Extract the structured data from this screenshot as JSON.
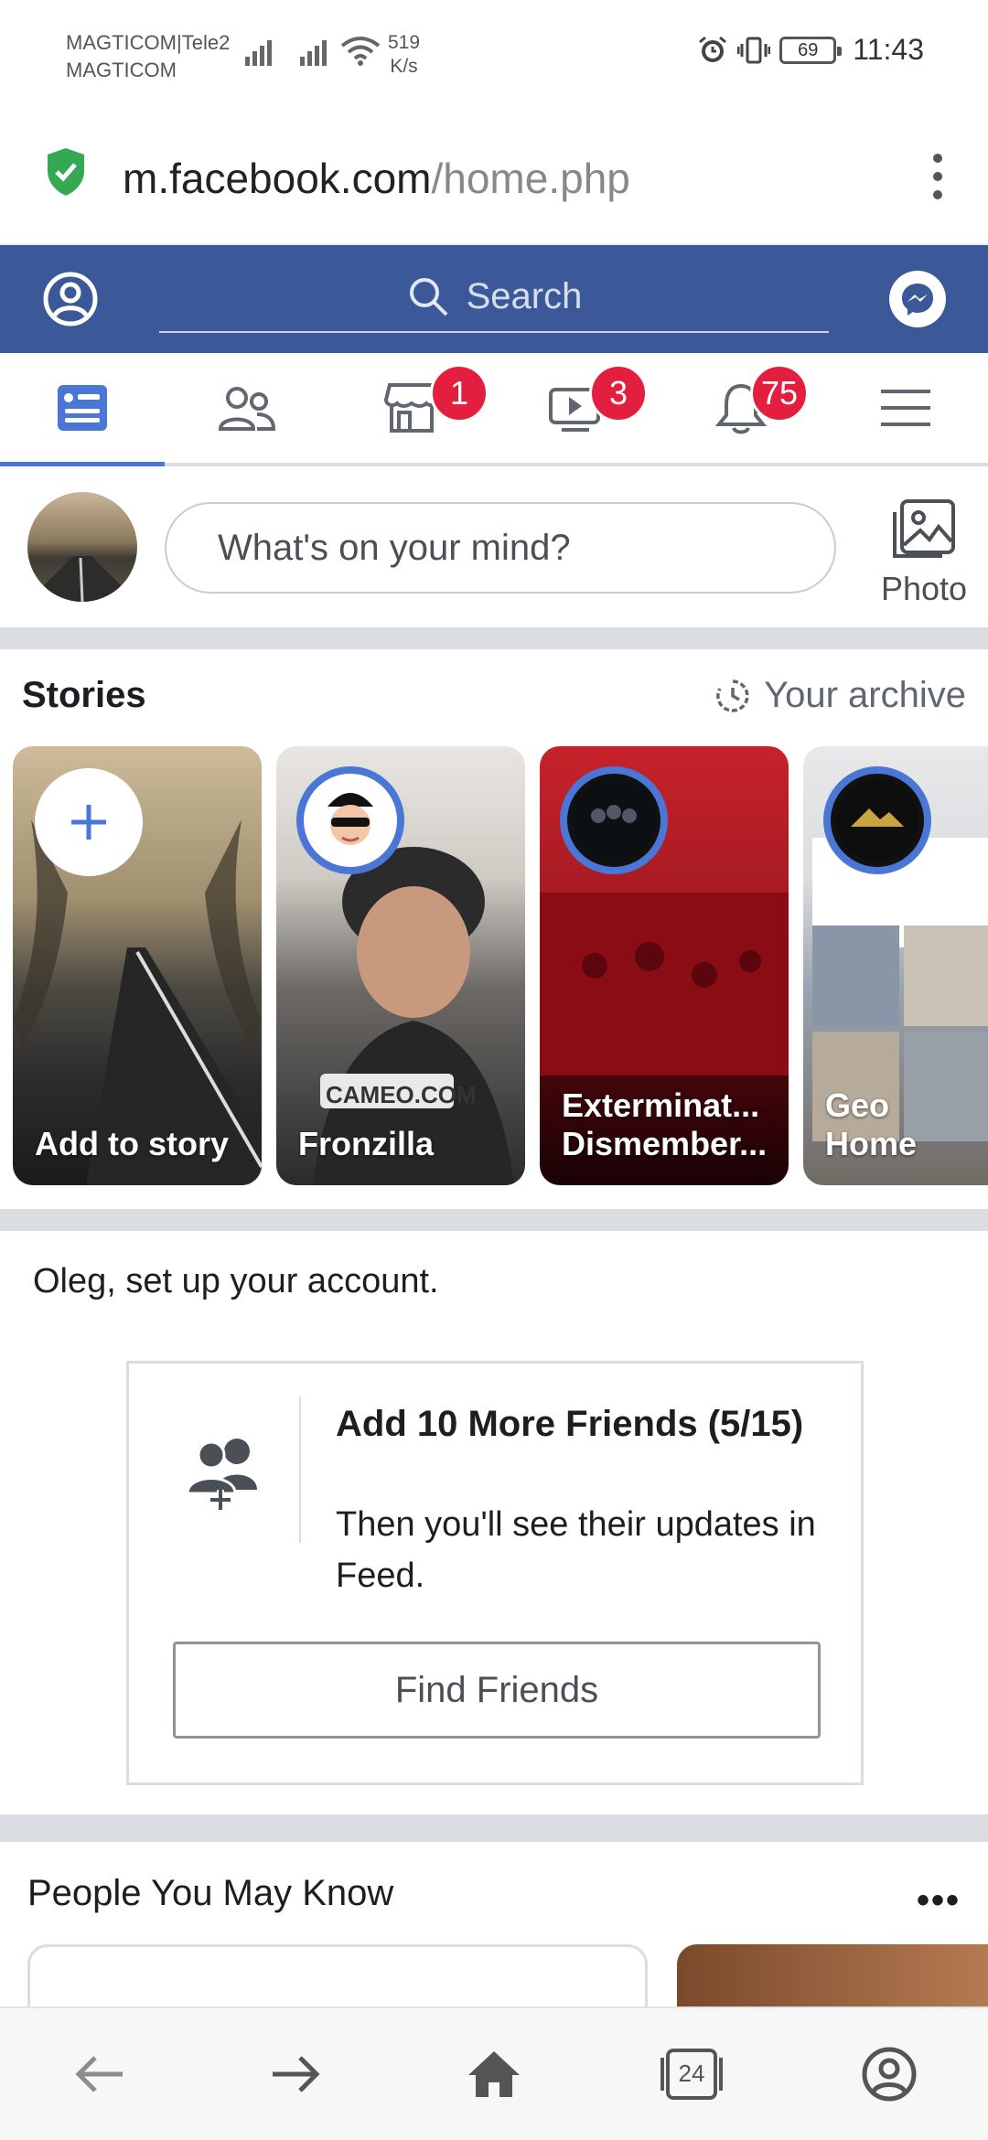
{
  "status_bar": {
    "carrier_line1": "MAGTICOM|Tele2",
    "carrier_line2": "MAGTICOM",
    "speed_value": "519",
    "speed_unit": "K/s",
    "battery": "69",
    "time": "11:43",
    "icons": [
      "signal-icon",
      "wifi-icon",
      "alarm-icon",
      "vibrate-icon",
      "battery-icon"
    ]
  },
  "browser": {
    "url_host": "m.facebook.com",
    "url_path": "/home.php",
    "icons": [
      "secure-shield-icon",
      "kebab-menu-icon"
    ]
  },
  "header": {
    "search_placeholder": "Search",
    "brand_color": "#3b5998",
    "icons": [
      "profile-icon",
      "search-icon",
      "messenger-icon"
    ]
  },
  "tabs": [
    {
      "name": "news-feed",
      "badge": ""
    },
    {
      "name": "friends",
      "badge": ""
    },
    {
      "name": "marketplace",
      "badge": "1"
    },
    {
      "name": "watch",
      "badge": "3"
    },
    {
      "name": "notifications",
      "badge": "75"
    },
    {
      "name": "menu",
      "badge": ""
    }
  ],
  "composer": {
    "placeholder": "What's on your mind?",
    "photo_label": "Photo"
  },
  "stories": {
    "title": "Stories",
    "archive_label": "Your archive",
    "items": [
      {
        "label": "Add to story"
      },
      {
        "label": "Fronzilla",
        "overlay": "CAMEO.COM"
      },
      {
        "label": "Exterminat... Dismember..."
      },
      {
        "label": "Geo Home"
      }
    ]
  },
  "setup": {
    "heading": "Oleg, set up your account.",
    "card_title": "Add 10 More Friends (5/15)",
    "card_sub": "Then you'll see their updates in Feed.",
    "button": "Find Friends"
  },
  "pymk": {
    "title": "People You May Know",
    "more": "•••"
  },
  "bottom_nav": {
    "tabs_count": "24",
    "icons": [
      "back-icon",
      "forward-icon",
      "home-icon",
      "tabs-icon",
      "account-icon"
    ]
  }
}
